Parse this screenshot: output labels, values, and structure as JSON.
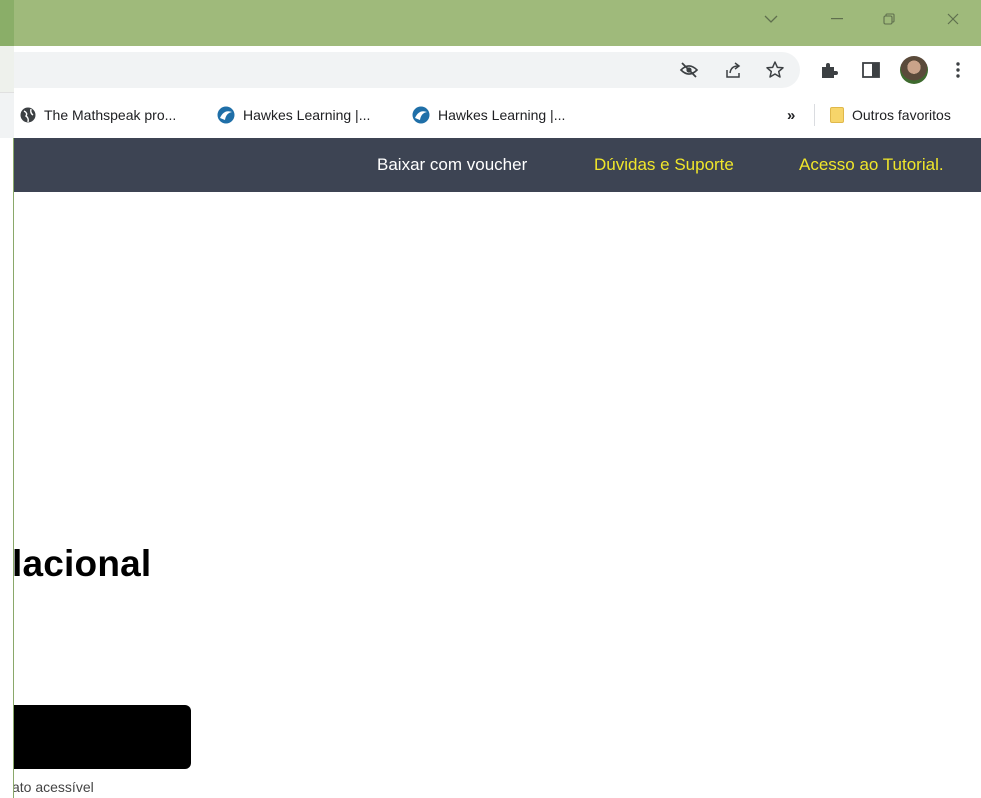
{
  "browser": {
    "bookmarks": [
      {
        "label": "The Mathspeak pro..."
      },
      {
        "label": "Hawkes Learning |..."
      },
      {
        "label": "Hawkes Learning |..."
      }
    ],
    "overflow_label": "»",
    "other_favorites": "Outros favoritos"
  },
  "site_nav": {
    "links": [
      {
        "label": "Baixar com voucher",
        "color": "#ffffff"
      },
      {
        "label": "Dúvidas e Suporte",
        "color": "#f0e62a"
      },
      {
        "label": "Acesso ao Tutorial.",
        "color": "#f0e62a"
      }
    ]
  },
  "content": {
    "heading": "lacional",
    "small_text": "ato acessível"
  },
  "colors": {
    "titlebar": "#9fba7b",
    "nav_bg": "#3d4453",
    "accent_yellow": "#f0e62a"
  },
  "icons": [
    "chevron-down-icon",
    "minimize-icon",
    "restore-icon",
    "close-icon",
    "eye-off-icon",
    "share-icon",
    "star-icon",
    "extensions-icon",
    "side-panel-icon",
    "avatar",
    "more-vert-icon"
  ]
}
